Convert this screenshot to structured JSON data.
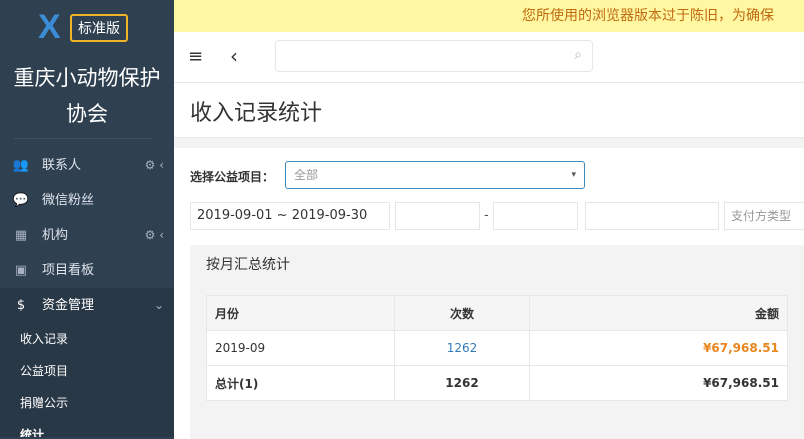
{
  "brand": {
    "logo_letter": "X",
    "edition": "标准版",
    "org_name_line1": "重庆小动物保护",
    "org_name_line2": "协会"
  },
  "sidebar": {
    "items": [
      {
        "label": "联系人",
        "icon": "users-icon",
        "glyph": "👥"
      },
      {
        "label": "微信粉丝",
        "icon": "chat-icon",
        "glyph": "💬"
      },
      {
        "label": "机构",
        "icon": "building-icon",
        "glyph": "▦"
      },
      {
        "label": "项目看板",
        "icon": "inbox-icon",
        "glyph": "▣"
      },
      {
        "label": "资金管理",
        "icon": "dollar-icon",
        "glyph": "$"
      }
    ],
    "gear_glyph": "⚙",
    "chev_left": "‹",
    "chev_down": "⌄",
    "sub_items": [
      "收入记录",
      "公益项目",
      "捐赠公示",
      "统计"
    ]
  },
  "warning": {
    "text": "您所使用的浏览器版本过于陈旧，为确保"
  },
  "navbar": {
    "hamburger": "≡",
    "back": "‹",
    "search_placeholder": "",
    "search_icon": "⌕"
  },
  "page": {
    "title": "收入记录统计"
  },
  "filters": {
    "project_label": "选择公益项目：",
    "project_value": "全部",
    "caret": "▾",
    "date_range": "2019-09-01 ~ 2019-09-30",
    "range_sep": "-",
    "payment_placeholder": "支付方类型"
  },
  "panel": {
    "title": "按月汇总统计"
  },
  "table": {
    "headers": [
      "月份",
      "次数",
      "金额"
    ],
    "rows": [
      {
        "month": "2019-09",
        "count": "1262",
        "amount": "¥67,968.51"
      }
    ],
    "total": {
      "label": "总计(1)",
      "count": "1262",
      "amount": "¥67,968.51"
    }
  },
  "colors": {
    "sidebar_bg": "#2f4050",
    "accent_blue": "#337ab7",
    "amount_orange": "#e8871e",
    "warning_bg": "#fff7a1"
  }
}
